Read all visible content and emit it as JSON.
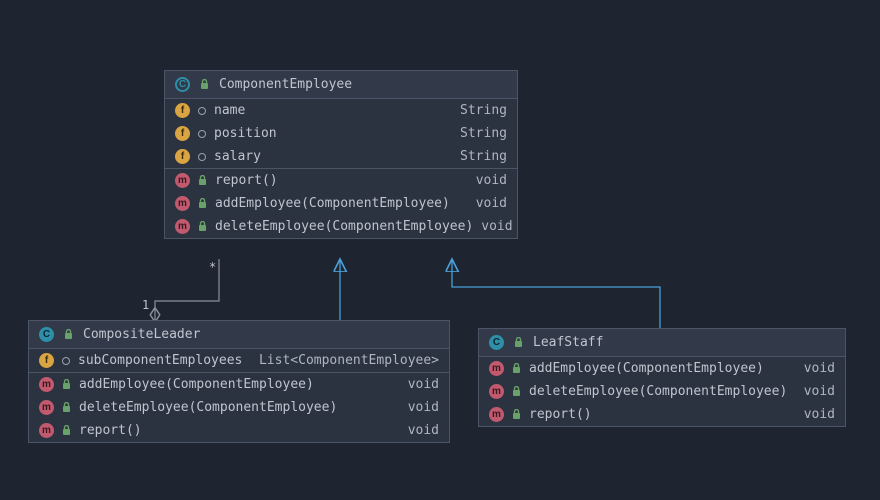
{
  "componentEmployee": {
    "title": "ComponentEmployee",
    "fields": [
      {
        "name": "name",
        "type": "String"
      },
      {
        "name": "position",
        "type": "String"
      },
      {
        "name": "salary",
        "type": "String"
      }
    ],
    "methods": [
      {
        "name": "report()",
        "type": "void"
      },
      {
        "name": "addEmployee(ComponentEmployee)",
        "type": "void"
      },
      {
        "name": "deleteEmployee(ComponentEmployee)",
        "type": "void"
      }
    ]
  },
  "compositeLeader": {
    "title": "CompositeLeader",
    "fields": [
      {
        "name": "subComponentEmployees",
        "type": "List<ComponentEmployee>"
      }
    ],
    "methods": [
      {
        "name": "addEmployee(ComponentEmployee)",
        "type": "void"
      },
      {
        "name": "deleteEmployee(ComponentEmployee)",
        "type": "void"
      },
      {
        "name": "report()",
        "type": "void"
      }
    ]
  },
  "leafStaff": {
    "title": "LeafStaff",
    "methods": [
      {
        "name": "addEmployee(ComponentEmployee)",
        "type": "void"
      },
      {
        "name": "deleteEmployee(ComponentEmployee)",
        "type": "void"
      },
      {
        "name": "report()",
        "type": "void"
      }
    ]
  },
  "multiplicity": {
    "one": "1",
    "many": "*"
  },
  "colors": {
    "bg": "#1e2430",
    "box": "#2b3240",
    "border": "#4b5566",
    "arrow": "#4a9fd8",
    "line": "#8a909c"
  },
  "iconLetters": {
    "class": "C",
    "field": "f",
    "method": "m"
  }
}
